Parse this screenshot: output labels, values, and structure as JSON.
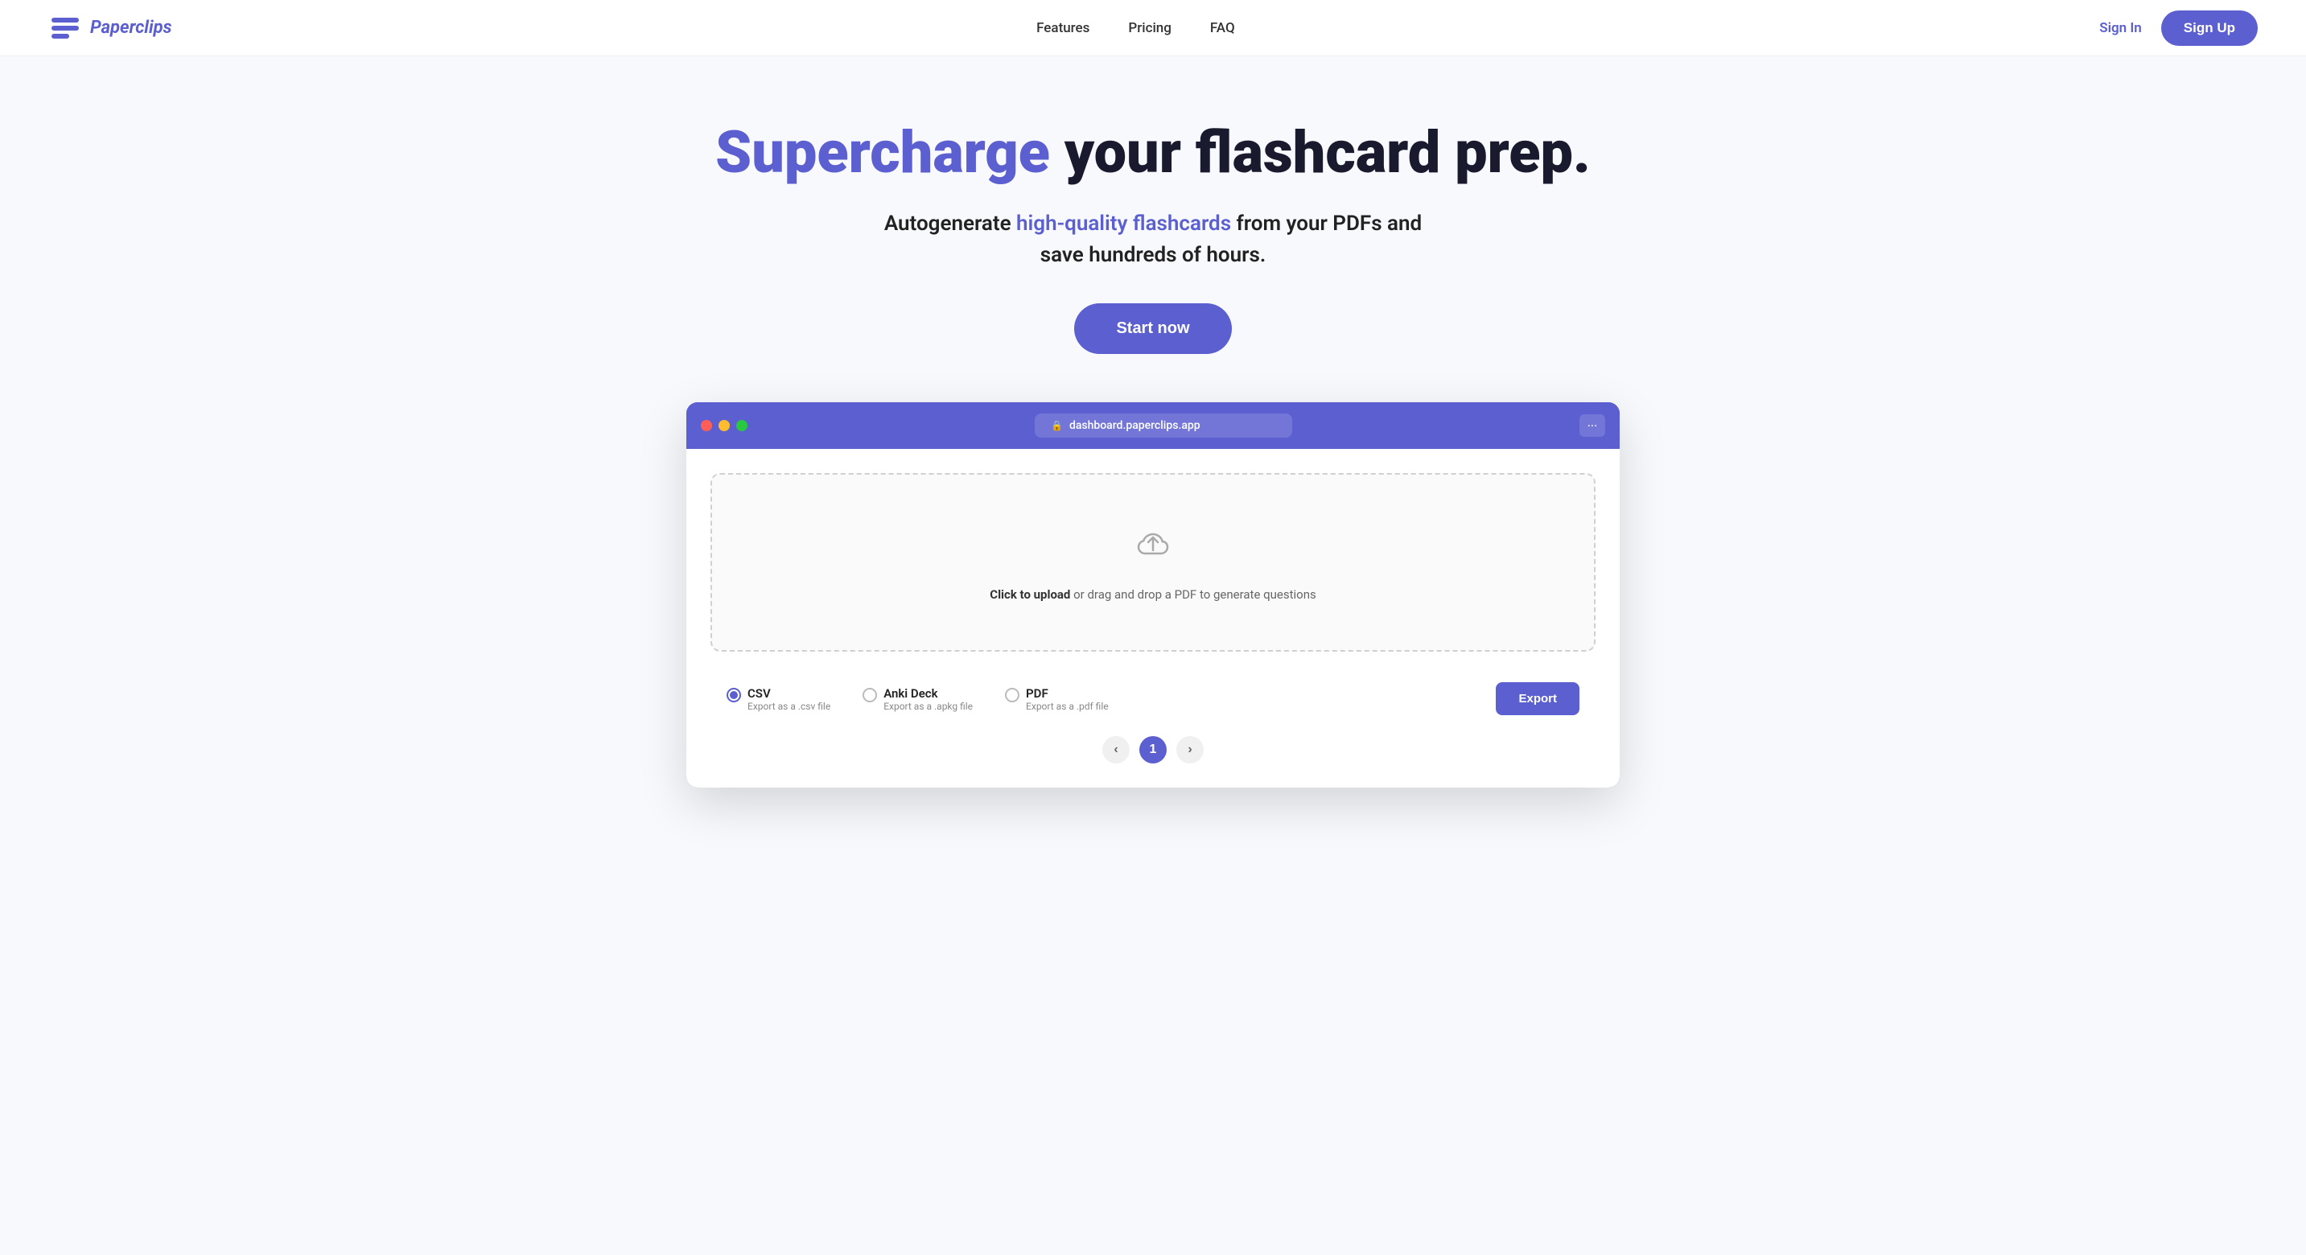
{
  "nav": {
    "logo_text": "Paperclips",
    "links": [
      {
        "label": "Features",
        "id": "features"
      },
      {
        "label": "Pricing",
        "id": "pricing"
      },
      {
        "label": "FAQ",
        "id": "faq"
      }
    ],
    "signin_label": "Sign In",
    "signup_label": "Sign Up"
  },
  "hero": {
    "title_accent": "Supercharge",
    "title_rest": " your flashcard prep.",
    "subtitle_before": "Autogenerate ",
    "subtitle_accent": "high-quality flashcards",
    "subtitle_after": " from your PDFs and save hundreds of hours.",
    "cta_label": "Start now"
  },
  "browser": {
    "address_text": "dashboard.paperclips.app",
    "dot_colors": [
      "dot-red",
      "dot-yellow",
      "dot-green"
    ]
  },
  "upload": {
    "cta_text": "Click to upload",
    "rest_text": " or drag and drop a PDF to generate questions"
  },
  "export": {
    "options": [
      {
        "id": "csv",
        "label": "CSV",
        "sub": "Export as a .csv file",
        "selected": true
      },
      {
        "id": "anki",
        "label": "Anki Deck",
        "sub": "Export as a .apkg file",
        "selected": false
      },
      {
        "id": "pdf",
        "label": "PDF",
        "sub": "Export as a .pdf file",
        "selected": false
      }
    ],
    "button_label": "Export"
  },
  "pagination": {
    "prev": "‹",
    "current": "1",
    "next": "›"
  }
}
